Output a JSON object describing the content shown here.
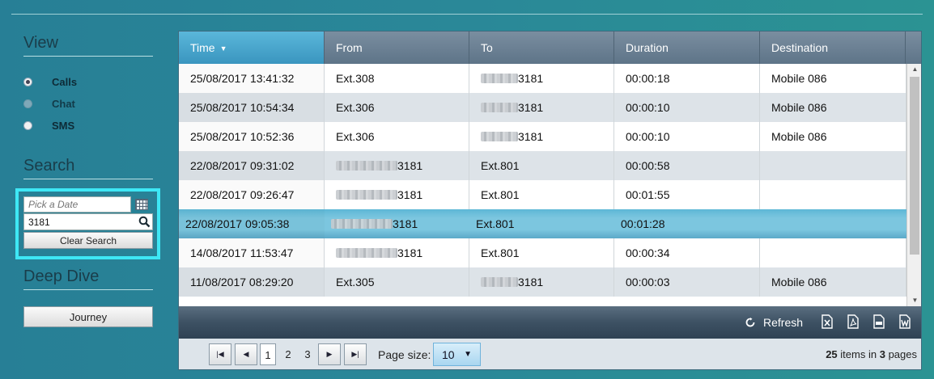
{
  "sidebar": {
    "view_title": "View",
    "view_options": [
      {
        "label": "Calls",
        "checked": true,
        "disabled": false
      },
      {
        "label": "Chat",
        "checked": false,
        "disabled": true
      },
      {
        "label": "SMS",
        "checked": false,
        "disabled": false
      }
    ],
    "search_title": "Search",
    "date_placeholder": "Pick a Date",
    "search_value": "3181",
    "clear_label": "Clear Search",
    "deep_dive_title": "Deep Dive",
    "journey_label": "Journey"
  },
  "grid": {
    "columns": [
      "Time",
      "From",
      "To",
      "Duration",
      "Destination"
    ],
    "sorted_column": "Time",
    "rows": [
      {
        "time": "25/08/2017 13:41:32",
        "from": "Ext.308",
        "from_redacted": false,
        "to": "3181",
        "to_redacted": true,
        "duration": "00:00:18",
        "destination": "Mobile 086"
      },
      {
        "time": "25/08/2017 10:54:34",
        "from": "Ext.306",
        "from_redacted": false,
        "to": "3181",
        "to_redacted": true,
        "duration": "00:00:10",
        "destination": "Mobile 086"
      },
      {
        "time": "25/08/2017 10:52:36",
        "from": "Ext.306",
        "from_redacted": false,
        "to": "3181",
        "to_redacted": true,
        "duration": "00:00:10",
        "destination": "Mobile 086"
      },
      {
        "time": "22/08/2017 09:31:02",
        "from": "3181",
        "from_redacted": true,
        "to": "Ext.801",
        "to_redacted": false,
        "duration": "00:00:58",
        "destination": ""
      },
      {
        "time": "22/08/2017 09:26:47",
        "from": "3181",
        "from_redacted": true,
        "to": "Ext.801",
        "to_redacted": false,
        "duration": "00:01:55",
        "destination": ""
      },
      {
        "time": "22/08/2017 09:05:38",
        "from": "3181",
        "from_redacted": true,
        "to": "Ext.801",
        "to_redacted": false,
        "duration": "00:01:28",
        "destination": "",
        "selected": true
      },
      {
        "time": "14/08/2017 11:53:47",
        "from": "3181",
        "from_redacted": true,
        "to": "Ext.801",
        "to_redacted": false,
        "duration": "00:00:34",
        "destination": ""
      },
      {
        "time": "11/08/2017 08:29:20",
        "from": "Ext.305",
        "from_redacted": false,
        "to": "3181",
        "to_redacted": true,
        "duration": "00:00:03",
        "destination": "Mobile 086"
      }
    ]
  },
  "toolbar": {
    "refresh_label": "Refresh",
    "export_icons": [
      "excel-icon",
      "pdf-icon",
      "csv-icon",
      "word-icon"
    ]
  },
  "pager": {
    "pages": [
      "1",
      "2",
      "3"
    ],
    "current_page": "1",
    "page_size_label": "Page size:",
    "page_size_value": "10",
    "total_items": "25",
    "total_pages": "3",
    "items_in_text": "items in",
    "pages_text": "pages"
  },
  "colors": {
    "background": "#2a8898",
    "highlight_border": "#3ee7f5",
    "selected_row": "#7cc6df",
    "header": "#6a7f92"
  }
}
